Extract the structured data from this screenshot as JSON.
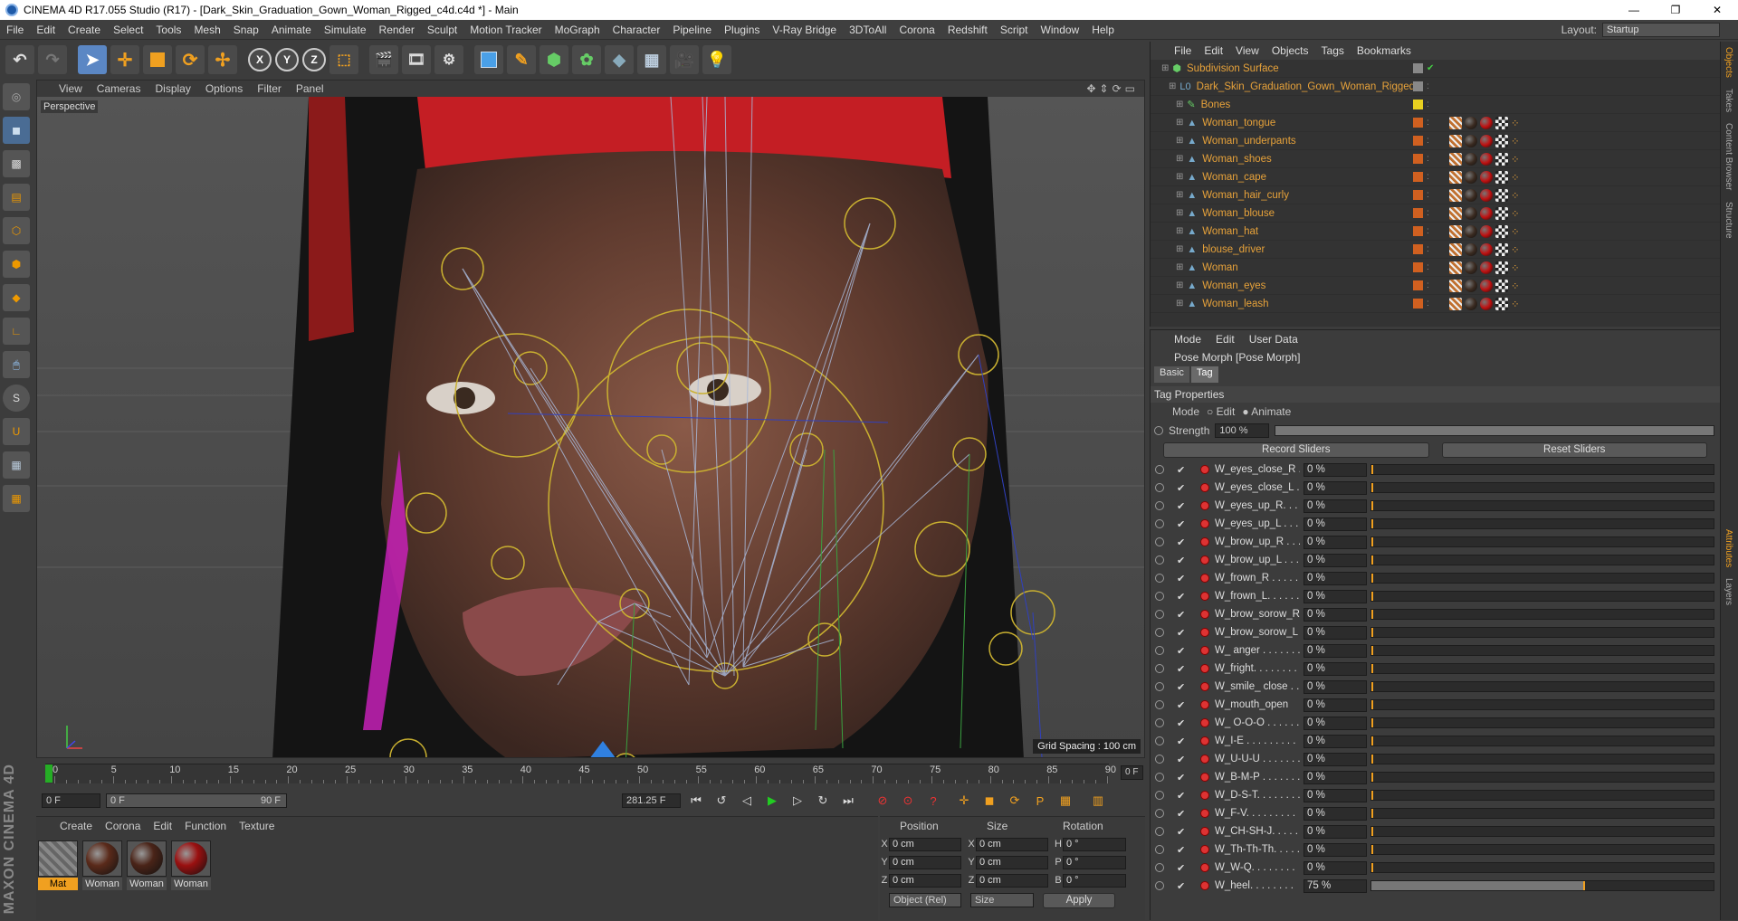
{
  "window": {
    "title": "CINEMA 4D R17.055 Studio (R17) - [Dark_Skin_Graduation_Gown_Woman_Rigged_c4d.c4d *] - Main",
    "min": "—",
    "max": "❐",
    "close": "✕"
  },
  "menu": [
    "File",
    "Edit",
    "Create",
    "Select",
    "Tools",
    "Mesh",
    "Snap",
    "Animate",
    "Simulate",
    "Render",
    "Sculpt",
    "Motion Tracker",
    "MoGraph",
    "Character",
    "Pipeline",
    "Plugins",
    "V-Ray Bridge",
    "3DToAll",
    "Corona",
    "Redshift",
    "Script",
    "Window",
    "Help"
  ],
  "layout": {
    "label": "Layout:",
    "value": "Startup"
  },
  "toolbar": {
    "x": "X",
    "y": "Y",
    "z": "Z"
  },
  "viewport": {
    "menu": [
      "View",
      "Cameras",
      "Display",
      "Options",
      "Filter",
      "Panel"
    ],
    "label": "Perspective",
    "grid": "Grid Spacing : 100 cm"
  },
  "timeline": {
    "ticks": [
      "0",
      "5",
      "10",
      "15",
      "20",
      "25",
      "30",
      "35",
      "40",
      "45",
      "50",
      "55",
      "60",
      "65",
      "70",
      "75",
      "80",
      "85",
      "90"
    ],
    "frame": "0 F",
    "start": "0 F",
    "range_start": "0 F",
    "range_end": "90 F",
    "end": "281.25 F"
  },
  "materials": {
    "menu": [
      "Create",
      "Corona",
      "Edit",
      "Function",
      "Texture"
    ],
    "items": [
      {
        "label": "Mat",
        "color": "#888"
      },
      {
        "label": "Woman",
        "color": "#5a2a1a"
      },
      {
        "label": "Woman",
        "color": "#4a2418"
      },
      {
        "label": "Woman",
        "color": "#9a1010"
      }
    ]
  },
  "coords": {
    "headers": [
      "Position",
      "Size",
      "Rotation"
    ],
    "rows": [
      {
        "a": "X",
        "p": "0 cm",
        "s": "X",
        "sv": "0 cm",
        "r": "H",
        "rv": "0 °"
      },
      {
        "a": "Y",
        "p": "0 cm",
        "s": "Y",
        "sv": "0 cm",
        "r": "P",
        "rv": "0 °"
      },
      {
        "a": "Z",
        "p": "0 cm",
        "s": "Z",
        "sv": "0 cm",
        "r": "B",
        "rv": "0 °"
      }
    ],
    "mode": "Object (Rel)",
    "size": "Size",
    "apply": "Apply"
  },
  "objects": {
    "menu": [
      "File",
      "Edit",
      "View",
      "Objects",
      "Tags",
      "Bookmarks"
    ],
    "items": [
      "Subdivision Surface",
      "Dark_Skin_Graduation_Gown_Woman_Rigged",
      "Bones",
      "Woman_tongue",
      "Woman_underpants",
      "Woman_shoes",
      "Woman_cape",
      "Woman_hair_curly",
      "Woman_blouse",
      "Woman_hat",
      "blouse_driver",
      "Woman",
      "Woman_eyes",
      "Woman_leash"
    ]
  },
  "attributes": {
    "menu": [
      "Mode",
      "Edit",
      "User Data"
    ],
    "title": "Pose Morph [Pose Morph]",
    "tabs": [
      "Basic",
      "Tag"
    ],
    "section": "Tag Properties",
    "mode_label": "Mode",
    "mode_edit": "Edit",
    "mode_animate": "Animate",
    "strength_label": "Strength",
    "strength_value": "100 %",
    "record": "Record Sliders",
    "reset": "Reset Sliders",
    "sliders": [
      {
        "name": "W_eyes_close_R . . .",
        "value": "0 %",
        "fill": 0
      },
      {
        "name": "W_eyes_close_L . . .",
        "value": "0 %",
        "fill": 0
      },
      {
        "name": "W_eyes_up_R. . . . .",
        "value": "0 %",
        "fill": 0
      },
      {
        "name": "W_eyes_up_L . . . . .",
        "value": "0 %",
        "fill": 0
      },
      {
        "name": "W_brow_up_R . . . .",
        "value": "0 %",
        "fill": 0
      },
      {
        "name": "W_brow_up_L . . . .",
        "value": "0 %",
        "fill": 0
      },
      {
        "name": "W_frown_R . . . . . .",
        "value": "0 %",
        "fill": 0
      },
      {
        "name": "W_frown_L. . . . . . .",
        "value": "0 %",
        "fill": 0
      },
      {
        "name": "W_brow_sorow_R",
        "value": "0 %",
        "fill": 0
      },
      {
        "name": "W_brow_sorow_L",
        "value": "0 %",
        "fill": 0
      },
      {
        "name": "W_ anger . . . . . . .",
        "value": "0 %",
        "fill": 0
      },
      {
        "name": "W_fright. . . . . . . .",
        "value": "0 %",
        "fill": 0
      },
      {
        "name": "W_smile_ close . . .",
        "value": "0 %",
        "fill": 0
      },
      {
        "name": "W_mouth_open",
        "value": "0 %",
        "fill": 0
      },
      {
        "name": "W_ O-O-O . . . . . .",
        "value": "0 %",
        "fill": 0
      },
      {
        "name": "W_I-E . . . . . . . . .",
        "value": "0 %",
        "fill": 0
      },
      {
        "name": "W_U-U-U . . . . . . .",
        "value": "0 %",
        "fill": 0
      },
      {
        "name": "W_B-M-P . . . . . . .",
        "value": "0 %",
        "fill": 0
      },
      {
        "name": "W_D-S-T. . . . . . . .",
        "value": "0 %",
        "fill": 0
      },
      {
        "name": "W_F-V. . . . . . . . .",
        "value": "0 %",
        "fill": 0
      },
      {
        "name": "W_CH-SH-J. . . . . .",
        "value": "0 %",
        "fill": 0
      },
      {
        "name": "W_Th-Th-Th. . . . .",
        "value": "0 %",
        "fill": 0
      },
      {
        "name": "W_W-Q. . . . . . . .",
        "value": "0 %",
        "fill": 0
      },
      {
        "name": "W_heel. . . . . . . .",
        "value": "75 %",
        "fill": 0.62
      }
    ]
  },
  "side_tabs": [
    "Objects",
    "Takes",
    "Content Browser",
    "Structure",
    "Attributes",
    "Layers"
  ],
  "brand": "MAXON CINEMA 4D"
}
